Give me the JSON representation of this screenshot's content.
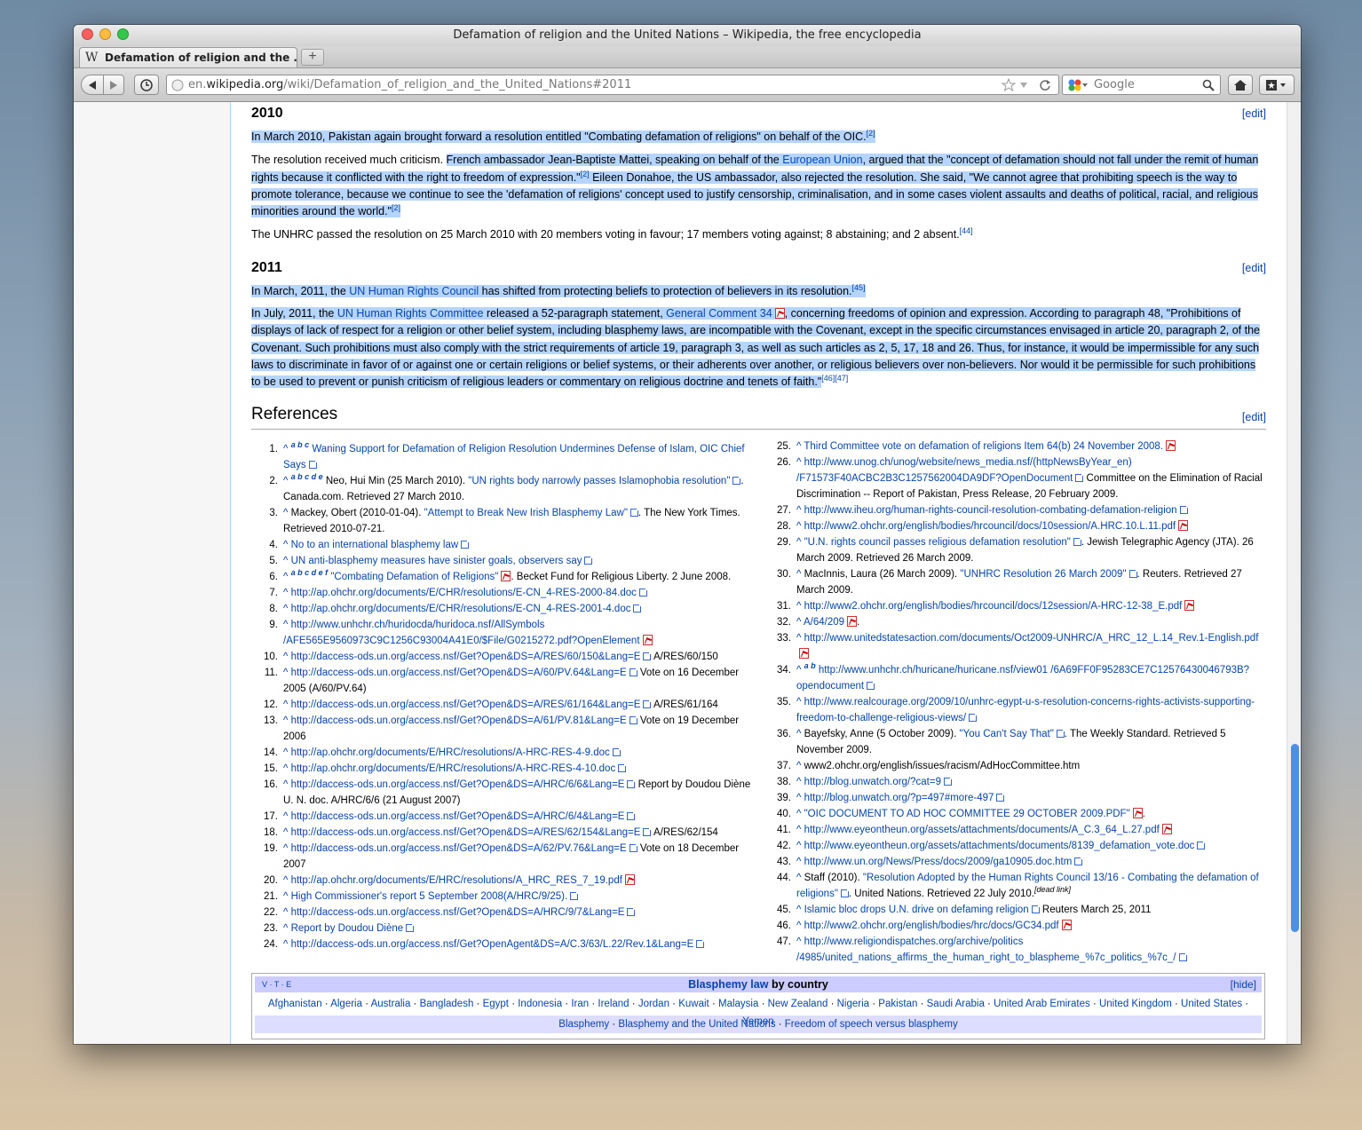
{
  "window": {
    "title": "Defamation of religion and the United Nations – Wikipedia, the free encyclopedia",
    "tab_label": "Defamation of religion and the ...",
    "new_tab": "+"
  },
  "navbar": {
    "url_prefix": "en.",
    "url_domain": "wikipedia.org",
    "url_path": "/wiki/Defamation_of_religion_and_the_United_Nations#2011",
    "search_placeholder": "Google"
  },
  "colors": {
    "selection": "#b5d5ff",
    "link": "#0645ad",
    "scroll_thumb": "#4d8fe0"
  },
  "section_2010": {
    "heading": "2010",
    "edit": "[edit]",
    "p1": {
      "pre": "In March 2010, Pakistan again brought forward a resolution entitled \"Combating defamation of religions\" on behalf of the OIC.",
      "sup": "[2]"
    },
    "p2": {
      "a": "The resolution received much criticism. ",
      "b": "French ambassador Jean-Baptiste Mattei, speaking on behalf of the ",
      "link": "European Union",
      "c": ", argued that the \"concept of defamation should not fall under the remit of human rights because it conflicted with the right to freedom of expression.\"",
      "sup1": "[2]",
      "d": " Eileen Donahoe, the US ambassador, also rejected the resolution. She said, \"We cannot agree that prohibiting speech is the way to promote tolerance, because we continue to see the 'defamation of religions' concept used to justify censorship, criminalisation, and in some cases violent assaults and deaths of political, racial, and religious minorities around the world.\"",
      "sup2": "[2]"
    },
    "p3": {
      "text": "The UNHRC passed the resolution on 25 March 2010 with 20 members voting in favour; 17 members voting against; 8 abstaining; and 2 absent.",
      "sup": "[44]"
    }
  },
  "section_2011": {
    "heading": "2011",
    "edit": "[edit]",
    "p1": {
      "a": "In March, 2011, the ",
      "link": "UN Human Rights Council",
      "b": " has shifted from protecting beliefs to protection of believers in its resolution.",
      "sup": "[45]"
    },
    "p2": {
      "a": "In July, 2011, the ",
      "link1": "UN Human Rights Committee",
      "b": " released a 52-paragraph statement, ",
      "link2": "General Comment 34",
      "c": ", concerning freedoms of opinion and expression. According to paragraph 48, \"Prohibitions of displays of lack of respect for a religion or other belief system, including blasphemy laws, are incompatible with the Covenant, except in the specific circumstances envisaged in article 20, paragraph 2, of the Covenant. Such prohibitions must also comply with the strict requirements of article 19, paragraph 3, as well as such articles as 2, 5, 17, 18 and 26. Thus, for instance, it would be impermissible for any such laws to discriminate in favor of or against one or certain religions or belief systems, or their adherents over another, or religious believers over non-believers. Nor would it be permissible for such prohibitions to be used to prevent or punish criticism of religious leaders or commentary on religious doctrine and tenets of faith.\"",
      "sup": "[46][47]"
    }
  },
  "references": {
    "heading": "References",
    "edit": "[edit]",
    "left": [
      {
        "n": "1.",
        "caret": "^",
        "sups": "a b c",
        "link": "Waning Support for Defamation of Religion Resolution Undermines Defense of Islam, OIC Chief Says",
        "icon": "ext",
        "tail": ""
      },
      {
        "n": "2.",
        "caret": "^",
        "sups": "a b c d e",
        "pre": "Neo, Hui Min (25 March 2010). ",
        "link": "\"UN rights body narrowly passes Islamophobia resolution\"",
        "icon": "ext",
        "tail": ". Canada.com. Retrieved 27 March 2010."
      },
      {
        "n": "3.",
        "caret": "^",
        "sups": "",
        "pre": "Mackey, Obert (2010-01-04). ",
        "link": "\"Attempt to Break New Irish Blasphemy Law\"",
        "icon": "ext",
        "tail": ". The New York Times. Retrieved 2010-07-21."
      },
      {
        "n": "4.",
        "caret": "^",
        "sups": "",
        "link": "No to an international blasphemy law",
        "icon": "ext",
        "tail": ""
      },
      {
        "n": "5.",
        "caret": "^",
        "sups": "",
        "link": "UN anti-blasphemy measures have sinister goals, observers say",
        "icon": "ext",
        "tail": ""
      },
      {
        "n": "6.",
        "caret": "^",
        "sups": "a b c d e f",
        "link": "\"Combating Defamation of Religions\"",
        "icon": "pdf",
        "tail": ". Becket Fund for Religious Liberty. 2 June 2008."
      },
      {
        "n": "7.",
        "caret": "^",
        "sups": "",
        "link": "http://ap.ohchr.org/documents/E/CHR/resolutions/E-CN_4-RES-2000-84.doc",
        "icon": "ext",
        "tail": ""
      },
      {
        "n": "8.",
        "caret": "^",
        "sups": "",
        "link": "http://ap.ohchr.org/documents/E/CHR/resolutions/E-CN_4-RES-2001-4.doc",
        "icon": "ext",
        "tail": ""
      },
      {
        "n": "9.",
        "caret": "^",
        "sups": "",
        "link": "http://www.unhchr.ch/huridocda/huridoca.nsf/AllSymbols /AFE565E9560973C9C1256C93004A41E0/$File/G0215272.pdf?OpenElement",
        "icon": "pdf",
        "tail": ""
      },
      {
        "n": "10.",
        "caret": "^",
        "sups": "",
        "link": "http://daccess-ods.un.org/access.nsf/Get?Open&DS=A/RES/60/150&Lang=E",
        "icon": "ext",
        "tail": " A/RES/60/150"
      },
      {
        "n": "11.",
        "caret": "^",
        "sups": "",
        "link": "http://daccess-ods.un.org/access.nsf/Get?Open&DS=A/60/PV.64&Lang=E",
        "icon": "ext",
        "tail": " Vote on 16 December 2005 (A/60/PV.64)"
      },
      {
        "n": "12.",
        "caret": "^",
        "sups": "",
        "link": "http://daccess-ods.un.org/access.nsf/Get?Open&DS=A/RES/61/164&Lang=E",
        "icon": "ext",
        "tail": " A/RES/61/164"
      },
      {
        "n": "13.",
        "caret": "^",
        "sups": "",
        "link": "http://daccess-ods.un.org/access.nsf/Get?Open&DS=A/61/PV.81&Lang=E",
        "icon": "ext",
        "tail": " Vote on 19 December 2006"
      },
      {
        "n": "14.",
        "caret": "^",
        "sups": "",
        "link": "http://ap.ohchr.org/documents/E/HRC/resolutions/A-HRC-RES-4-9.doc",
        "icon": "ext",
        "tail": ""
      },
      {
        "n": "15.",
        "caret": "^",
        "sups": "",
        "link": "http://ap.ohchr.org/documents/E/HRC/resolutions/A-HRC-RES-4-10.doc",
        "icon": "ext",
        "tail": ""
      },
      {
        "n": "16.",
        "caret": "^",
        "sups": "",
        "link": "http://daccess-ods.un.org/access.nsf/Get?Open&DS=A/HRC/6/6&Lang=E",
        "icon": "ext",
        "tail": " Report by Doudou Diène U. N. doc. A/HRC/6/6 (21 August 2007)"
      },
      {
        "n": "17.",
        "caret": "^",
        "sups": "",
        "link": "http://daccess-ods.un.org/access.nsf/Get?Open&DS=A/HRC/6/4&Lang=E",
        "icon": "ext",
        "tail": ""
      },
      {
        "n": "18.",
        "caret": "^",
        "sups": "",
        "link": "http://daccess-ods.un.org/access.nsf/Get?Open&DS=A/RES/62/154&Lang=E",
        "icon": "ext",
        "tail": " A/RES/62/154"
      },
      {
        "n": "19.",
        "caret": "^",
        "sups": "",
        "link": "http://daccess-ods.un.org/access.nsf/Get?Open&DS=A/62/PV.76&Lang=E",
        "icon": "ext",
        "tail": " Vote on 18 December 2007"
      },
      {
        "n": "20.",
        "caret": "^",
        "sups": "",
        "link": "http://ap.ohchr.org/documents/E/HRC/resolutions/A_HRC_RES_7_19.pdf",
        "icon": "pdf",
        "tail": ""
      },
      {
        "n": "21.",
        "caret": "^",
        "sups": "",
        "link": "High Commissioner's report 5 September 2008(A/HRC/9/25).",
        "icon": "ext",
        "tail": ""
      },
      {
        "n": "22.",
        "caret": "^",
        "sups": "",
        "link": "http://daccess-ods.un.org/access.nsf/Get?Open&DS=A/HRC/9/7&Lang=E",
        "icon": "ext",
        "tail": ""
      },
      {
        "n": "23.",
        "caret": "^",
        "sups": "",
        "link": "Report by Doudou Diène",
        "icon": "ext",
        "tail": ""
      },
      {
        "n": "24.",
        "caret": "^",
        "sups": "",
        "link": "http://daccess-ods.un.org/access.nsf/Get?OpenAgent&DS=A/C.3/63/L.22/Rev.1&Lang=E",
        "icon": "ext",
        "tail": ""
      }
    ],
    "right": [
      {
        "n": "25.",
        "caret": "^",
        "sups": "",
        "link": "Third Committee vote on defamation of religions Item 64(b) 24 November 2008.",
        "icon": "pdf",
        "tail": ""
      },
      {
        "n": "26.",
        "caret": "^",
        "sups": "",
        "link": "http://www.unog.ch/unog/website/news_media.nsf/(httpNewsByYear_en) /F71573F40ACBC2B3C1257562004DA9DF?OpenDocument",
        "icon": "ext",
        "tail": " Committee on the Elimination of Racial Discrimination -- Report of Pakistan, Press Release, 20 February 2009."
      },
      {
        "n": "27.",
        "caret": "^",
        "sups": "",
        "link": "http://www.iheu.org/human-rights-council-resolution-combating-defamation-religion",
        "icon": "ext",
        "tail": ""
      },
      {
        "n": "28.",
        "caret": "^",
        "sups": "",
        "link": "http://www2.ohchr.org/english/bodies/hrcouncil/docs/10session/A.HRC.10.L.11.pdf",
        "icon": "pdf",
        "tail": ""
      },
      {
        "n": "29.",
        "caret": "^",
        "sups": "",
        "link": "\"U.N. rights council passes religious defamation resolution\"",
        "icon": "ext",
        "tail": ". Jewish Telegraphic Agency (JTA). 26 March 2009. Retrieved 26 March 2009."
      },
      {
        "n": "30.",
        "caret": "^",
        "sups": "",
        "pre": "MacInnis, Laura (26 March 2009). ",
        "link": "\"UNHRC Resolution 26 March 2009\"",
        "icon": "ext",
        "tail": ". Reuters. Retrieved 27 March 2009."
      },
      {
        "n": "31.",
        "caret": "^",
        "sups": "",
        "link": "http://www2.ohchr.org/english/bodies/hrcouncil/docs/12session/A-HRC-12-38_E.pdf",
        "icon": "pdf",
        "tail": ""
      },
      {
        "n": "32.",
        "caret": "^",
        "sups": "",
        "link": "A/64/209",
        "icon": "pdf",
        "tail": "."
      },
      {
        "n": "33.",
        "caret": "^",
        "sups": "",
        "link": "http://www.unitedstatesaction.com/documents/Oct2009-UNHRC/A_HRC_12_L.14_Rev.1-English.pdf",
        "icon": "pdf",
        "tail": ""
      },
      {
        "n": "34.",
        "caret": "^",
        "sups": "a b",
        "link": "http://www.unhchr.ch/huricane/huricane.nsf/view01 /6A69FF0F95283CE7C12576430046793B?opendocument",
        "icon": "ext",
        "tail": ""
      },
      {
        "n": "35.",
        "caret": "^",
        "sups": "",
        "link": "http://www.realcourage.org/2009/10/unhrc-egypt-u-s-resolution-concerns-rights-activists-supporting-freedom-to-challenge-religious-views/",
        "icon": "ext",
        "tail": ""
      },
      {
        "n": "36.",
        "caret": "^",
        "sups": "",
        "pre": "Bayefsky, Anne (5 October 2009). ",
        "link": "\"You Can't Say That\"",
        "icon": "ext",
        "tail": ". The Weekly Standard. Retrieved 5 November 2009."
      },
      {
        "n": "37.",
        "caret": "^",
        "sups": "",
        "pre": "www2.ohchr.org/english/issues/racism/AdHocCommittee.htm",
        "link": "",
        "icon": "",
        "tail": ""
      },
      {
        "n": "38.",
        "caret": "^",
        "sups": "",
        "link": "http://blog.unwatch.org/?cat=9",
        "icon": "ext",
        "tail": ""
      },
      {
        "n": "39.",
        "caret": "^",
        "sups": "",
        "link": "http://blog.unwatch.org/?p=497#more-497",
        "icon": "ext",
        "tail": ""
      },
      {
        "n": "40.",
        "caret": "^",
        "sups": "",
        "link": "\"OIC DOCUMENT TO AD HOC COMMITTEE 29 OCTOBER 2009.PDF\"",
        "icon": "pdf",
        "tail": "."
      },
      {
        "n": "41.",
        "caret": "^",
        "sups": "",
        "link": "http://www.eyeontheun.org/assets/attachments/documents/A_C.3_64_L.27.pdf",
        "icon": "pdf",
        "tail": ""
      },
      {
        "n": "42.",
        "caret": "^",
        "sups": "",
        "link": "http://www.eyeontheun.org/assets/attachments/documents/8139_defamation_vote.doc",
        "icon": "ext",
        "tail": ""
      },
      {
        "n": "43.",
        "caret": "^",
        "sups": "",
        "link": "http://www.un.org/News/Press/docs/2009/ga10905.doc.htm",
        "icon": "ext",
        "tail": ""
      },
      {
        "n": "44.",
        "caret": "^",
        "sups": "",
        "pre": "Staff (2010). ",
        "link": "\"Resolution Adopted by the Human Rights Council 13/16 - Combating the defamation of religions\"",
        "icon": "ext",
        "tail": ". United Nations. Retrieved 22 July 2010.",
        "deadlink": "[dead link]"
      },
      {
        "n": "45.",
        "caret": "^",
        "sups": "",
        "link": "Islamic bloc drops U.N. drive on defaming religion",
        "icon": "ext",
        "tail": " Reuters March 25, 2011"
      },
      {
        "n": "46.",
        "caret": "^",
        "sups": "",
        "link": "http://www2.ohchr.org/english/bodies/hrc/docs/GC34.pdf",
        "icon": "pdf",
        "tail": ""
      },
      {
        "n": "47.",
        "caret": "^",
        "sups": "",
        "link": "http://www.religiondispatches.org/archive/politics /4985/united_nations_affirms_the_human_right_to_blaspheme_%7c_politics_%7c_/",
        "icon": "ext",
        "tail": ""
      }
    ]
  },
  "navbox": {
    "vte": "V · T · E",
    "title_link": "Blasphemy law",
    "title_rest": " by country",
    "hide": "[hide]",
    "countries": [
      "Afghanistan",
      "Algeria",
      "Australia",
      "Bangladesh",
      "Egypt",
      "Indonesia",
      "Iran",
      "Ireland",
      "Jordan",
      "Kuwait",
      "Malaysia",
      "New Zealand",
      "Nigeria",
      "Pakistan",
      "Saudi Arabia",
      "United Arab Emirates",
      "United Kingdom",
      "United States",
      "Yemen"
    ],
    "footer": [
      "Blasphemy",
      "Blasphemy and the United Nations",
      "Freedom of speech versus blasphemy"
    ]
  }
}
